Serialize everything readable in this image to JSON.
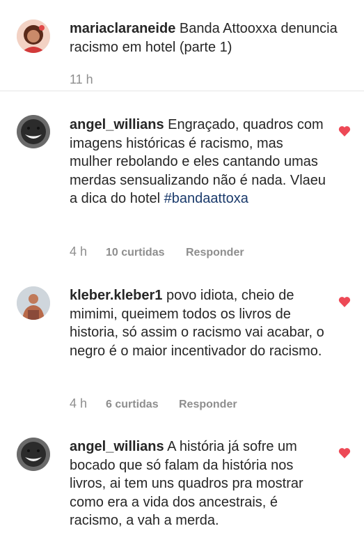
{
  "post": {
    "username": "mariaclaraneide",
    "text": " Banda Attooxxa denuncia racismo em hotel (parte 1)",
    "time": "11 h"
  },
  "comments": [
    {
      "username": "angel_willians",
      "text": " Engraçado, quadros com imagens históricas é racismo, mas mulher rebolando e eles cantando umas merdas sensualizando não é nada. Vlaeu a dica do hotel ",
      "hashtag": "#bandaattoxa",
      "time": "4 h",
      "likes": "10 curtidas",
      "reply": "Responder"
    },
    {
      "username": "kleber.kleber1",
      "text": " povo idiota, cheio de mimimi, queimem todos os livros de historia, só assim o racismo vai acabar, o negro é o maior incentivador do racismo.",
      "time": "4 h",
      "likes": "6 curtidas",
      "reply": "Responder"
    },
    {
      "username": "angel_willians",
      "text": " A história já sofre um bocado que só falam da história nos livros, ai tem uns quadros pra mostrar como era a vida dos ancestrais, é racismo, a vah a merda."
    }
  ],
  "colors": {
    "heart": "#ed4956",
    "meta": "#8e8e8e",
    "hashtag": "#1a3a6b"
  },
  "icons": [
    "heart-icon"
  ]
}
